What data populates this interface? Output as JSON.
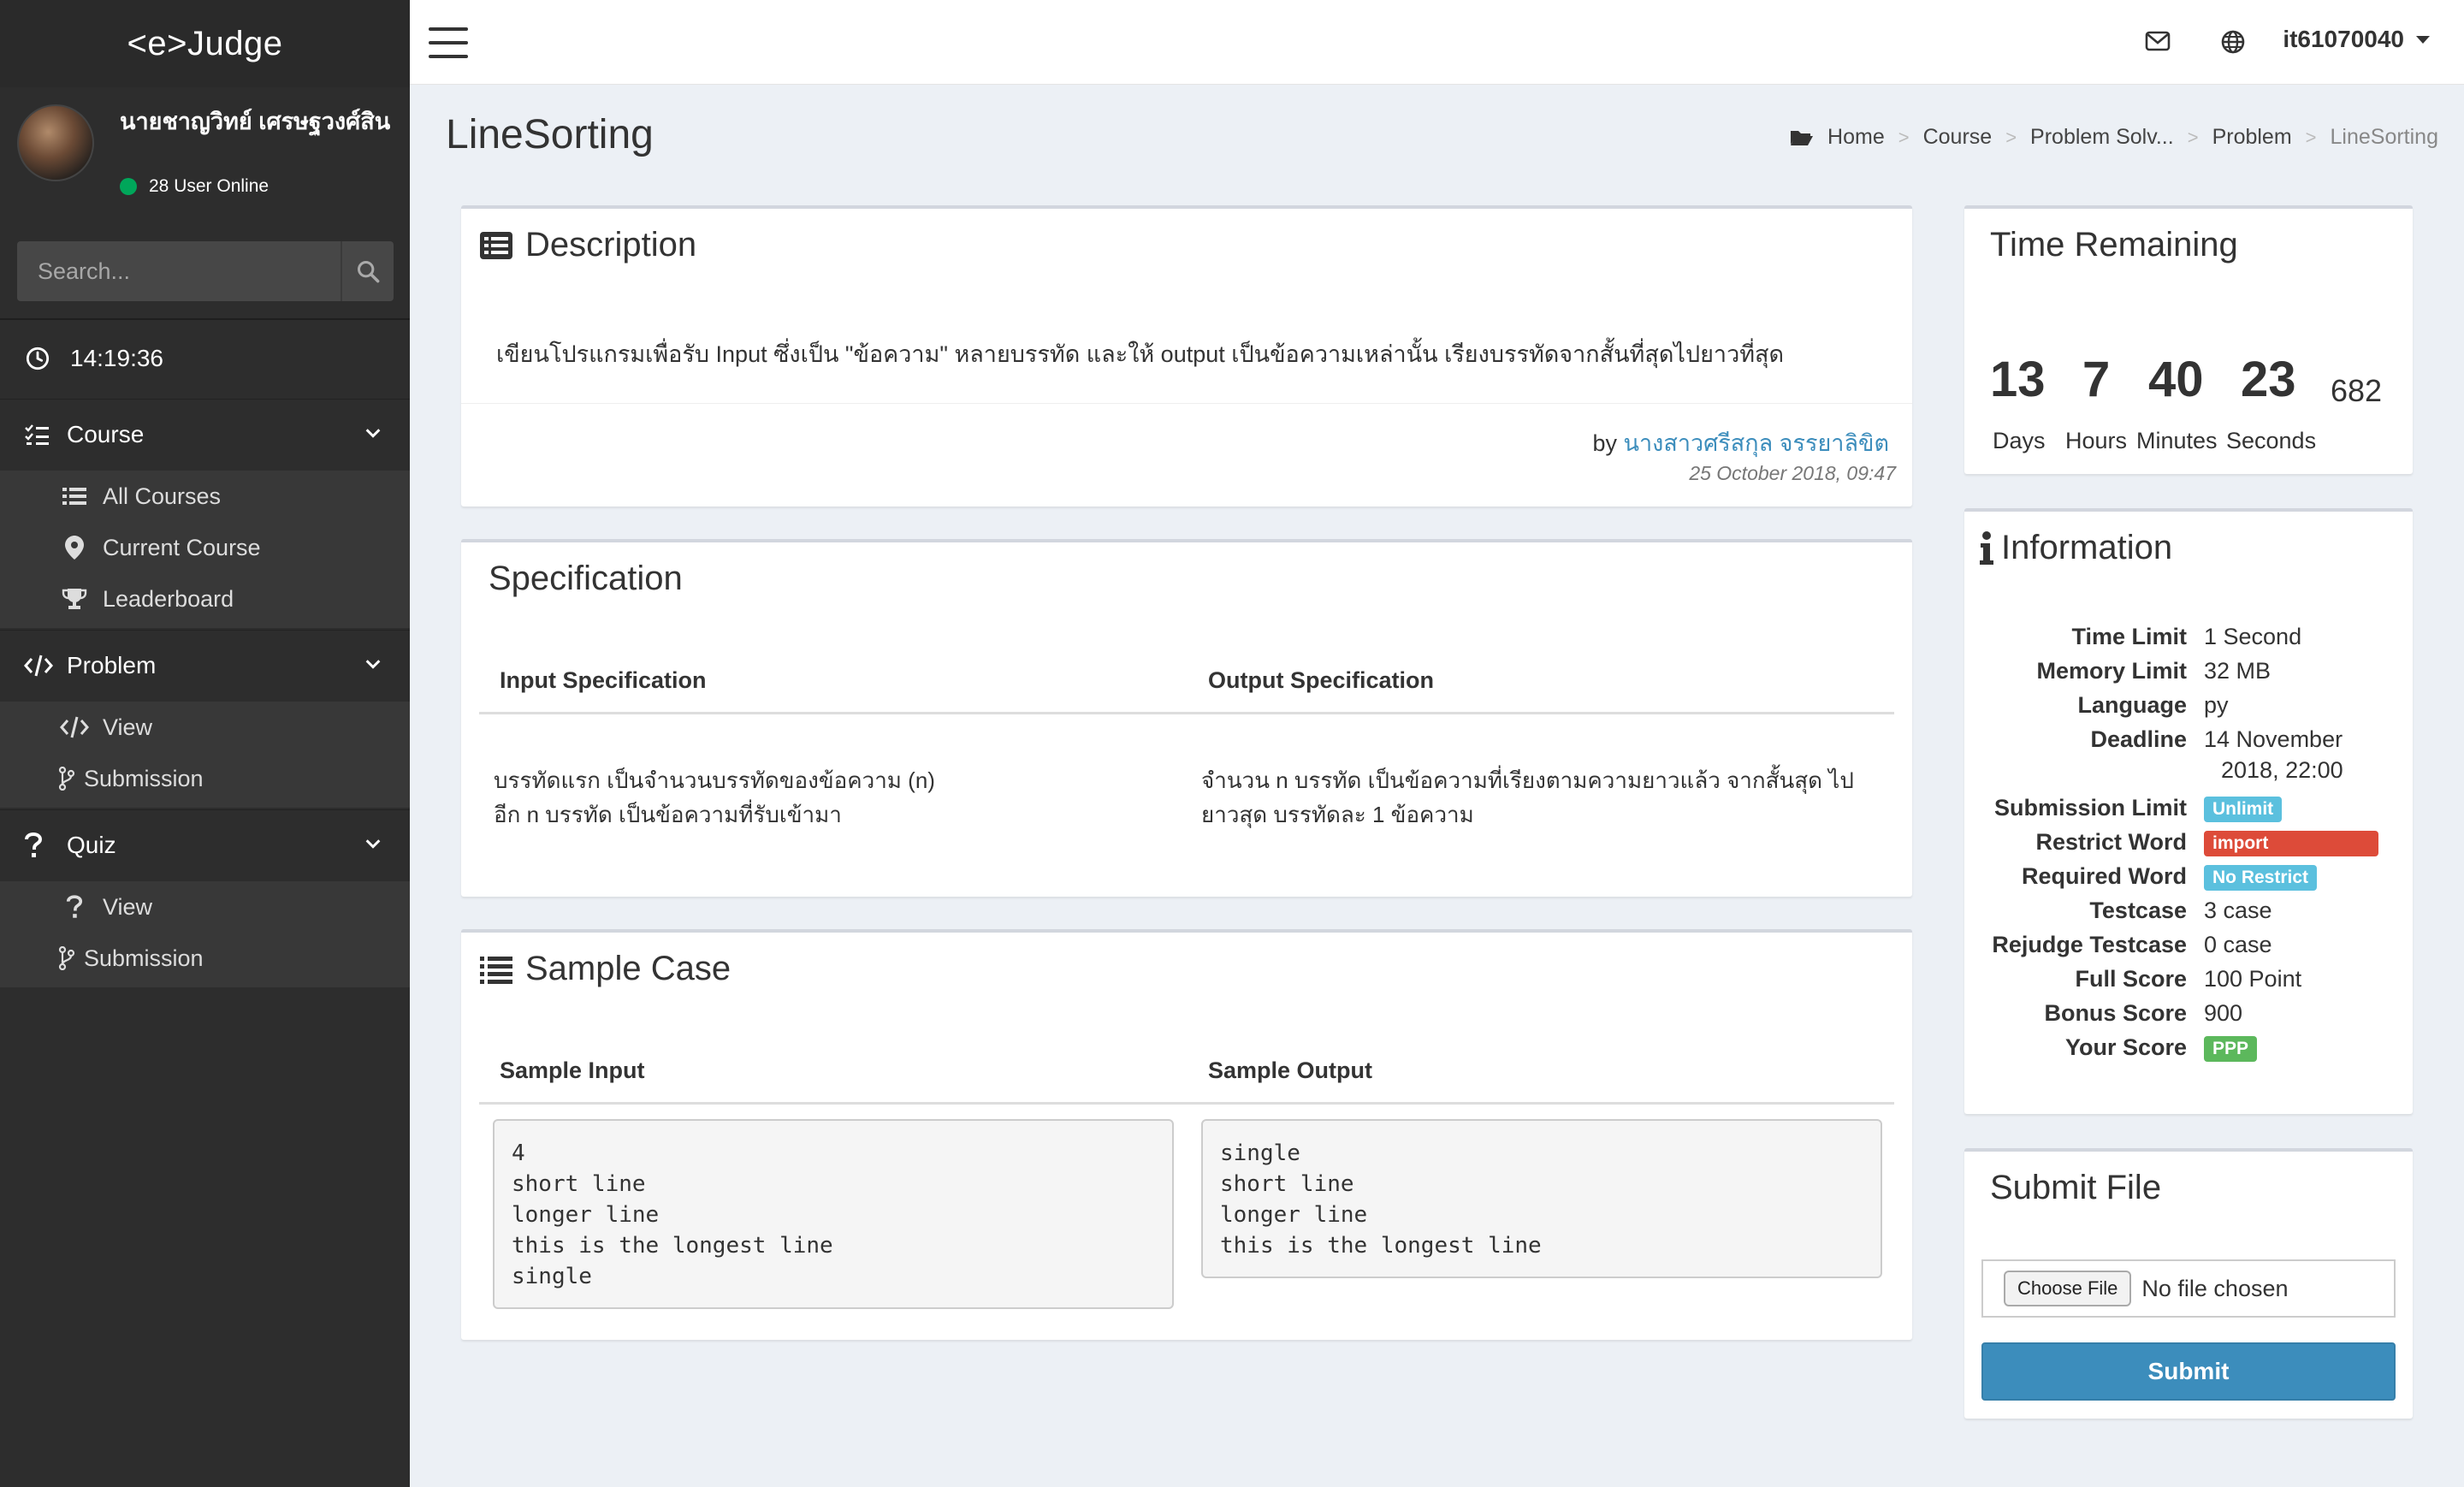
{
  "app": {
    "logo": "<e>Judge"
  },
  "user": {
    "name": "นายชาญวิทย์ เศรษฐวงศ์สิน",
    "online": "28 User Online",
    "username": "it61070040"
  },
  "search": {
    "placeholder": "Search..."
  },
  "clock": "14:19:36",
  "sidebar": {
    "course": {
      "label": "Course",
      "items": [
        "All Courses",
        "Current Course",
        "Leaderboard"
      ]
    },
    "problem": {
      "label": "Problem",
      "items": [
        "View",
        "Submission"
      ]
    },
    "quiz": {
      "label": "Quiz",
      "items": [
        "View",
        "Submission"
      ]
    }
  },
  "page": {
    "title": "LineSorting"
  },
  "breadcrumb": [
    "Home",
    "Course",
    "Problem Solv...",
    "Problem",
    "LineSorting"
  ],
  "description": {
    "title": "Description",
    "text": "เขียนโปรแกรมเพื่อรับ Input ซึ่งเป็น \"ข้อความ\" หลายบรรทัด และให้ output เป็นข้อความเหล่านั้น เรียงบรรทัดจากสั้นที่สุดไปยาวที่สุด",
    "by": "by",
    "author": "นางสาวศรีสกุล จรรยาลิขิต",
    "date": "25 October 2018, 09:47"
  },
  "specification": {
    "title": "Specification",
    "input_header": "Input Specification",
    "output_header": "Output Specification",
    "input_text": "บรรทัดแรก เป็นจำนวนบรรทัดของข้อความ (n)\nอีก n บรรทัด เป็นข้อความที่รับเข้ามา",
    "output_text": "จำนวน n บรรทัด เป็นข้อความที่เรียงตามความยาวแล้ว จากสั้นสุด ไป\nยาวสุด บรรทัดละ 1 ข้อความ"
  },
  "sample": {
    "title": "Sample Case",
    "input_header": "Sample Input",
    "output_header": "Sample Output",
    "input": "4\nshort line\nlonger line\nthis is the longest line\nsingle",
    "output": "single\nshort line\nlonger line\nthis is the longest line"
  },
  "time_remaining": {
    "title": "Time Remaining",
    "days": "13",
    "hours": "7",
    "minutes": "40",
    "seconds": "23",
    "ms": "682",
    "days_label": "Days",
    "hours_label": "Hours",
    "minutes_label": "Minutes",
    "seconds_label": "Seconds"
  },
  "information": {
    "title": "Information",
    "rows": [
      {
        "key": "Time Limit",
        "value": "1 Second"
      },
      {
        "key": "Memory Limit",
        "value": "32 MB"
      },
      {
        "key": "Language",
        "value": "py"
      },
      {
        "key": "Deadline",
        "value": "14 November",
        "value2": "2018, 22:00"
      },
      {
        "key": "Submission Limit",
        "value": "Unlimit"
      },
      {
        "key": "Restrict Word",
        "value": "import"
      },
      {
        "key": "Required Word",
        "value": "No Restrict"
      },
      {
        "key": "Testcase",
        "value": "3 case"
      },
      {
        "key": "Rejudge Testcase",
        "value": "0 case"
      },
      {
        "key": "Full Score",
        "value": "100 Point"
      },
      {
        "key": "Bonus Score",
        "value": "900"
      },
      {
        "key": "Your Score",
        "value": "PPP"
      }
    ]
  },
  "submit": {
    "title": "Submit File",
    "choose": "Choose File",
    "no_file": "No file chosen",
    "button": "Submit"
  },
  "colors": {
    "accent": "#3c8dbc",
    "sidebar": "#2d2d2d",
    "success": "#00a65a",
    "info": "#5bc0de",
    "danger": "#dd4b39"
  },
  "icons": {
    "topbar": [
      "hamburger-icon",
      "envelope-icon",
      "globe-icon"
    ],
    "sidebar": [
      "search-icon",
      "clock-icon",
      "list-check-icon",
      "list-icon",
      "map-marker-icon",
      "trophy-icon",
      "code-icon",
      "code-branch-icon",
      "question-icon"
    ],
    "content": [
      "folder-open-icon",
      "list-alt-icon",
      "list-ol-icon",
      "info-icon"
    ]
  }
}
